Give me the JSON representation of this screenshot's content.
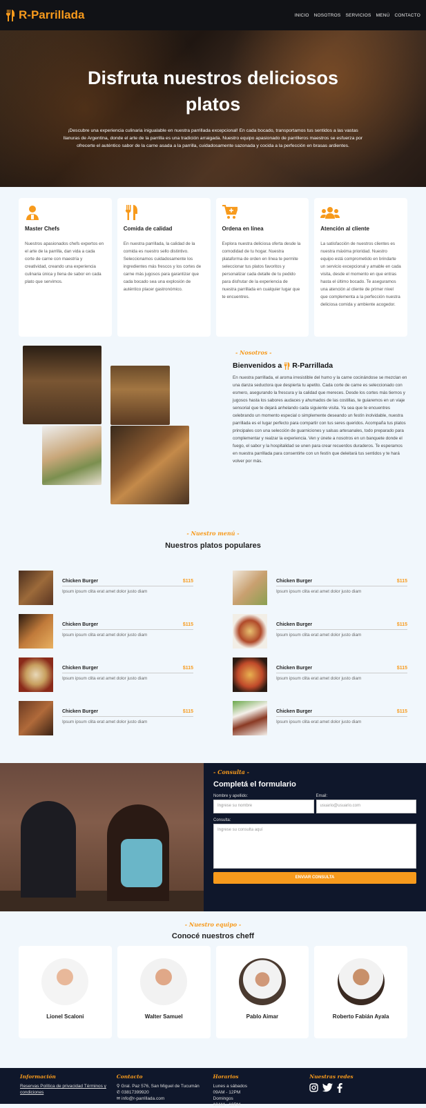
{
  "nav": {
    "brand": "R-Parrillada",
    "items": [
      "INICIO",
      "NOSOTROS",
      "SERVICIOS",
      "MENÚ",
      "CONTACTO"
    ]
  },
  "hero": {
    "title": "Disfruta nuestros deliciosos platos",
    "text": "¡Descubre una experiencia culinaria inigualable en nuestra parrillada excepcional! En cada bocado, transportamos tus sentidos a las vastas llanuras de Argentina, donde el arte de la parrilla es una tradición arraigada. Nuestro equipo apasionado de parrilleros maestros se esfuerza por ofrecerte el auténtico sabor de la carne asada a la parrilla, cuidadosamente sazonada y cocida a la perfección en brasas ardientes."
  },
  "services": [
    {
      "icon": "chef-icon",
      "title": "Master Chefs",
      "text": "Nuestros apasionados chefs expertos en el arte de la parrilla, dan vida a cada corte de carne con maestría y creatividad, creando una experiencia culinaria única y llena de sabor en cada plato que servimos."
    },
    {
      "icon": "utensils-icon",
      "title": "Comida de calidad",
      "text": "En nuestra parrillada, la calidad de la comida es nuestro sello distintivo. Seleccionamos cuidadosamente los ingredientes más frescos y los cortes de carne más jugosos para garantizar que cada bocado sea una explosión de auténtico placer gastronómico."
    },
    {
      "icon": "cart-plus-icon",
      "title": "Ordena en línea",
      "text": "Explora nuestra deliciosa oferta desde la comodidad de tu hogar. Nuestra plataforma de orden en línea te permite seleccionar tus platos favoritos y personalizar cada detalle de tu pedido para disfrutar de la experiencia de nuestra parrillada en cualquier lugar que te encuentres."
    },
    {
      "icon": "users-icon",
      "title": "Atención al cliente",
      "text": "La satisfacción de nuestros clientes es nuestra máxima prioridad. Nuestro equipo está comprometido en brindarte un servicio excepcional y amable en cada visita, desde el momento en que entras hasta el último bocado. Te aseguramos una atención al cliente de primer nivel que complementa a la perfección nuestra deliciosa comida y ambiente acogedor."
    }
  ],
  "about": {
    "kicker": "- Nosotros -",
    "title_prefix": "Bienvenidos a",
    "title_brand": "R-Parrillada",
    "text": "En nuestra parrillada, el aroma irresistible del humo y la carne cocinándose se mezclan en una danza seductora que despierta tu apetito. Cada corte de carne es seleccionado con esmero, asegurando la frescura y la calidad que mereces. Desde los cortes más tiernos y jugosos hasta los sabores audaces y ahumados de las costillas, te guiaremos en un viaje sensorial que te dejará anhelando cada siguiente visita. Ya sea que te encuentres celebrando un momento especial o simplemente deseando un festín inolvidable, nuestra parrillada es el lugar perfecto para compartir con tus seres queridos. Acompaña tus platos principales con una selección de guarniciones y salsas artesanales, todo preparado para complementar y realzar la experiencia. Ven y únete a nosotros en un banquete donde el fuego, el sabor y la hospitalidad se unen para crear recuerdos duraderos. Te esperamos en nuestra parrillada para consentirte con un festín que deleitará tus sentidos y te hará volver por más."
  },
  "menu": {
    "kicker": "- Nuestro menú -",
    "title": "Nuestros platos populares",
    "dishes": [
      {
        "name": "Chicken Burger",
        "price": "$115",
        "desc": "Ipsum ipsum clita erat amet dolor justo diam"
      },
      {
        "name": "Chicken Burger",
        "price": "$115",
        "desc": "Ipsum ipsum clita erat amet dolor justo diam"
      },
      {
        "name": "Chicken Burger",
        "price": "$115",
        "desc": "Ipsum ipsum clita erat amet dolor justo diam"
      },
      {
        "name": "Chicken Burger",
        "price": "$115",
        "desc": "Ipsum ipsum clita erat amet dolor justo diam"
      },
      {
        "name": "Chicken Burger",
        "price": "$115",
        "desc": "Ipsum ipsum clita erat amet dolor justo diam"
      },
      {
        "name": "Chicken Burger",
        "price": "$115",
        "desc": "Ipsum ipsum clita erat amet dolor justo diam"
      },
      {
        "name": "Chicken Burger",
        "price": "$115",
        "desc": "Ipsum ipsum clita erat amet dolor justo diam"
      },
      {
        "name": "Chicken Burger",
        "price": "$115",
        "desc": "Ipsum ipsum clita erat amet dolor justo diam"
      }
    ]
  },
  "contact": {
    "kicker": "- Consulta -",
    "title": "Completá el formulario",
    "name_label": "Nombre y apellido:",
    "name_placeholder": "Ingrese su nombre",
    "email_label": "Email:",
    "email_placeholder": "usuario@usuario.com",
    "query_label": "Consulta:",
    "query_placeholder": "Ingrese su consulta aquí",
    "submit": "ENVIAR CONSULTA"
  },
  "team": {
    "kicker": "- Nuestro equipo -",
    "title": "Conocé nuestros cheff",
    "chefs": [
      "Lionel Scaloni",
      "Walter Samuel",
      "Pablo Aimar",
      "Roberto Fabián Ayala"
    ]
  },
  "footer": {
    "info_title": "Información",
    "info_links": "Reservas Política de privacidad Términos y condiciones",
    "contact_title": "Contacto",
    "address": "Gral. Paz 576, San Miguel de Tucumán",
    "phone": "03817399920",
    "email": "info@r-parrillada.com",
    "hours_title": "Horarios",
    "hours_1": "Lunes a sábados",
    "hours_2": "09AM - 12PM",
    "hours_3": "Domingos",
    "hours_4": "10AM - 10PM",
    "social_title": "Nuestras redes"
  },
  "colors": {
    "accent": "#f79a1c",
    "dark": "#0f172b",
    "nav": "#111216",
    "bg": "#f1f7fc"
  }
}
